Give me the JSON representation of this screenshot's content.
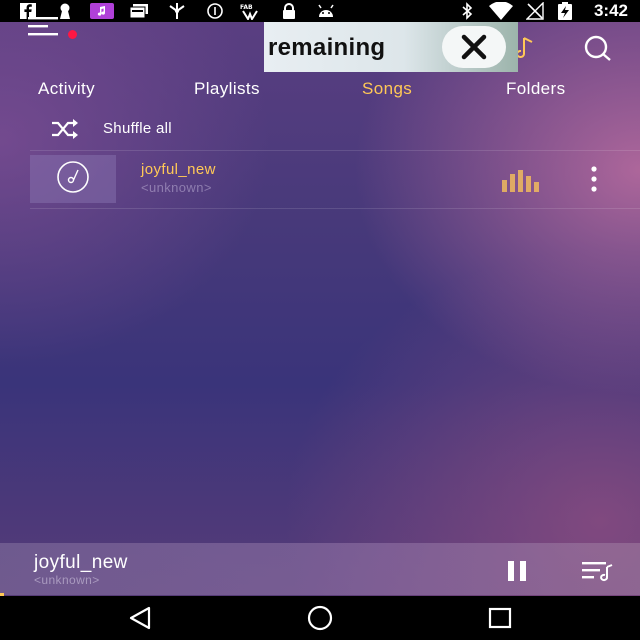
{
  "status_bar": {
    "time": "3:42",
    "left_icons": [
      "facebook-icon",
      "keyhole-icon",
      "music-app-icon",
      "card-icon",
      "wind-icon",
      "info-icon",
      "stamp-icon",
      "lock-icon",
      "android-icon"
    ],
    "right_icons": [
      "bluetooth-icon",
      "wifi-icon",
      "no-signal-icon",
      "battery-charging-icon"
    ]
  },
  "toolbar": {
    "menu_icon": "hamburger-menu-icon",
    "notification_dot_color": "#ff1744",
    "search_icon": "search-icon"
  },
  "ad_overlay": {
    "text": "remaining",
    "close_icon": "close-icon"
  },
  "tabs": [
    {
      "label": "Activity",
      "active": false
    },
    {
      "label": "Playlists",
      "active": false
    },
    {
      "label": "Songs",
      "active": true
    },
    {
      "label": "Folders",
      "active": false
    }
  ],
  "shuffle": {
    "label": "Shuffle all",
    "icon": "shuffle-icon"
  },
  "songs": [
    {
      "title": "joyful_new",
      "artist": "<unknown>",
      "playing": true
    }
  ],
  "mini_player": {
    "title": "joyful_new",
    "artist": "<unknown>",
    "pause_icon": "pause-icon",
    "queue_icon": "queue-icon"
  },
  "nav_bar": {
    "back_icon": "back-icon",
    "home_icon": "home-icon",
    "recents_icon": "recents-icon"
  },
  "colors": {
    "accent": "#ffc857",
    "status_bar": "#000000",
    "nav_bar": "#000000"
  }
}
